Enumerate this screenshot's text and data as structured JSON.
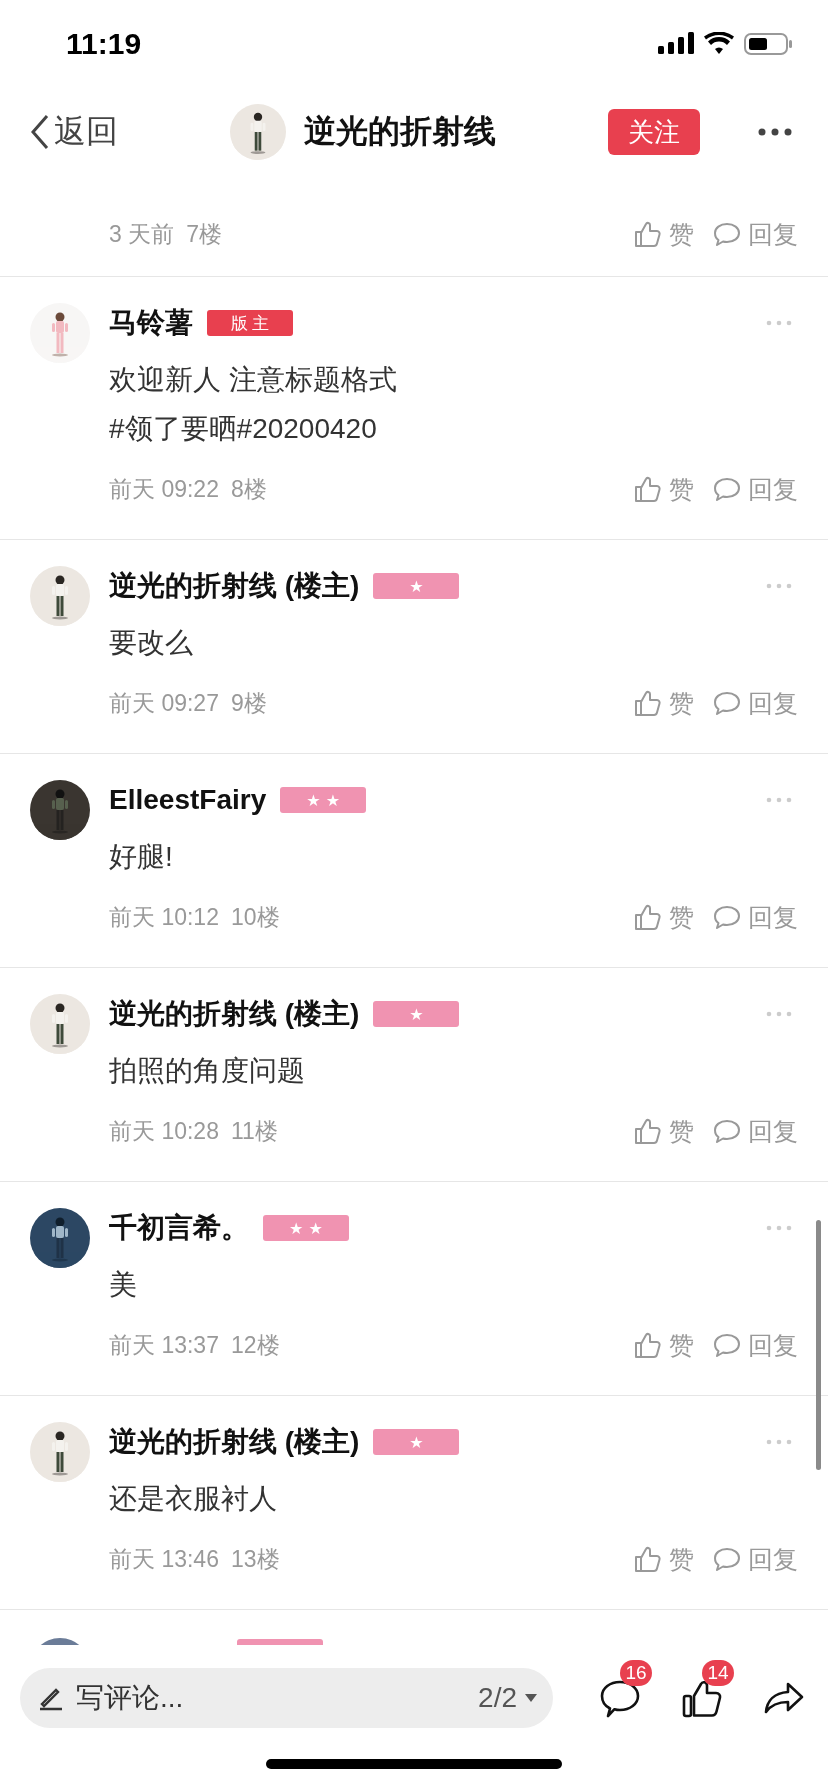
{
  "status_bar": {
    "time": "11:19"
  },
  "header": {
    "back_label": "返回",
    "title": "逆光的折射线",
    "follow_label": "关注"
  },
  "comments": [
    {
      "kind": "tail",
      "time": "3 天前",
      "floor": "7楼",
      "like_label": "赞",
      "reply_label": "回复"
    },
    {
      "kind": "full",
      "author": "马铃薯",
      "badge": {
        "kind": "role",
        "label": "版 主"
      },
      "lines": [
        "欢迎新人 注意标题格式",
        "#领了要晒#20200420"
      ],
      "time": "前天 09:22",
      "floor": "8楼",
      "like_label": "赞",
      "reply_label": "回复"
    },
    {
      "kind": "full",
      "author": "逆光的折射线 (楼主)",
      "badge": {
        "kind": "level",
        "label": "★"
      },
      "lines": [
        "要改么"
      ],
      "time": "前天 09:27",
      "floor": "9楼",
      "like_label": "赞",
      "reply_label": "回复"
    },
    {
      "kind": "full",
      "author": "ElleestFairy",
      "badge": {
        "kind": "level",
        "label": "★ ★"
      },
      "lines": [
        "好腿!"
      ],
      "time": "前天 10:12",
      "floor": "10楼",
      "like_label": "赞",
      "reply_label": "回复"
    },
    {
      "kind": "full",
      "author": "逆光的折射线 (楼主)",
      "badge": {
        "kind": "level",
        "label": "★"
      },
      "lines": [
        "拍照的角度问题"
      ],
      "time": "前天 10:28",
      "floor": "11楼",
      "like_label": "赞",
      "reply_label": "回复"
    },
    {
      "kind": "full",
      "author": "千初言希。",
      "badge": {
        "kind": "level",
        "label": "★ ★"
      },
      "lines": [
        "美"
      ],
      "time": "前天 13:37",
      "floor": "12楼",
      "like_label": "赞",
      "reply_label": "回复"
    },
    {
      "kind": "full",
      "author": "逆光的折射线 (楼主)",
      "badge": {
        "kind": "level",
        "label": "★"
      },
      "lines": [
        "还是衣服衬人"
      ],
      "time": "前天 13:46",
      "floor": "13楼",
      "like_label": "赞",
      "reply_label": "回复"
    },
    {
      "kind": "partial",
      "badge": {
        "kind": "level"
      }
    }
  ],
  "composer": {
    "placeholder": "写评论...",
    "page": "2/2"
  },
  "actions": [
    {
      "kind": "comment",
      "count": "16"
    },
    {
      "kind": "like",
      "count": "14"
    },
    {
      "kind": "share"
    }
  ]
}
